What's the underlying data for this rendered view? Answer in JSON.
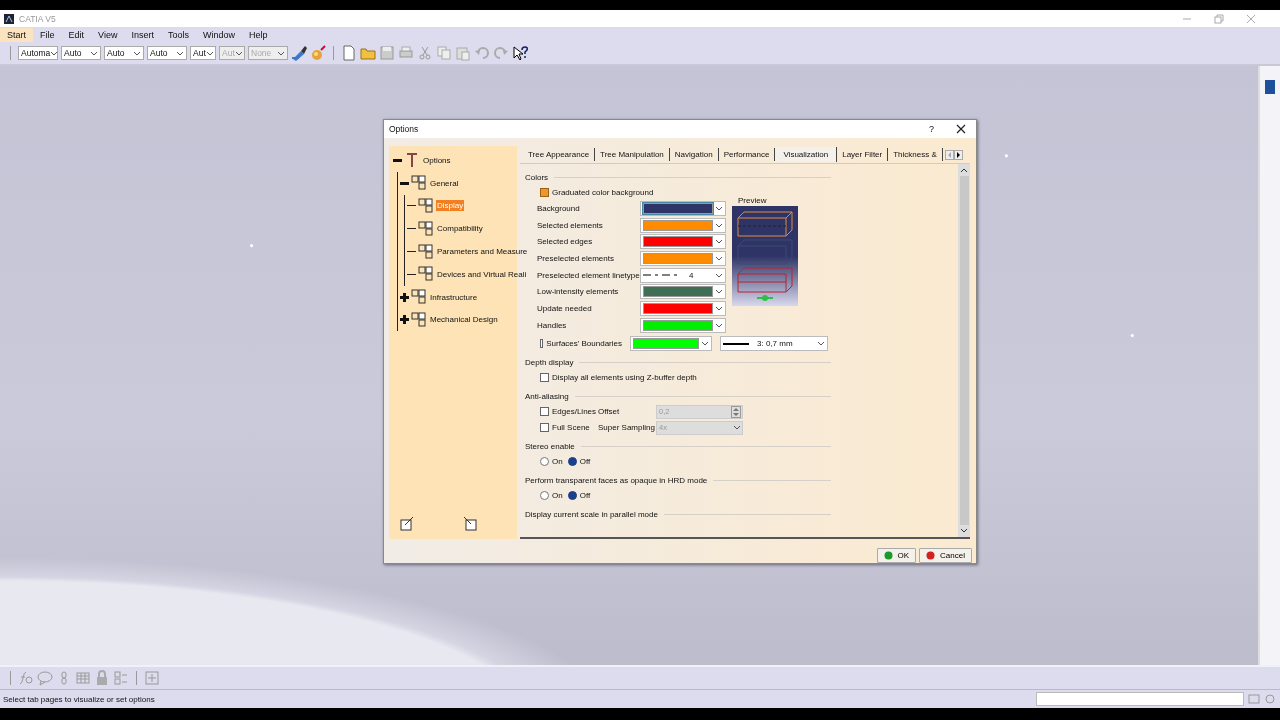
{
  "window": {
    "title": "CATIA V5"
  },
  "menu": [
    {
      "label": "Start",
      "selected": true
    },
    {
      "label": "File",
      "selected": false
    },
    {
      "label": "Edit",
      "selected": false
    },
    {
      "label": "View",
      "selected": false
    },
    {
      "label": "Insert",
      "selected": false
    },
    {
      "label": "Tools",
      "selected": false
    },
    {
      "label": "Window",
      "selected": false
    },
    {
      "label": "Help",
      "selected": false
    }
  ],
  "toolbar_combos": [
    {
      "value": "Automa",
      "disabled": false
    },
    {
      "value": "Auto",
      "disabled": false
    },
    {
      "value": "Auto",
      "disabled": false
    },
    {
      "value": "Auto",
      "disabled": false
    },
    {
      "value": "Aut",
      "disabled": false
    },
    {
      "value": "Aut",
      "disabled": true
    },
    {
      "value": "None",
      "disabled": true
    }
  ],
  "dialog": {
    "title": "Options",
    "help": "?",
    "tree": [
      {
        "label": "Options",
        "selected": false,
        "expanded": true,
        "children": [
          {
            "label": "General",
            "selected": false,
            "expanded": true,
            "children": [
              {
                "label": "Display",
                "selected": true
              },
              {
                "label": "Compatibility",
                "selected": false
              },
              {
                "label": "Parameters and Measure",
                "selected": false
              },
              {
                "label": "Devices and Virtual Reali",
                "selected": false
              }
            ]
          },
          {
            "label": "Infrastructure",
            "selected": false,
            "expanded": false
          },
          {
            "label": "Mechanical Design",
            "selected": false,
            "expanded": false
          }
        ]
      }
    ],
    "tabs": [
      {
        "label": "Tree Appearance",
        "selected": false
      },
      {
        "label": "Tree Manipulation",
        "selected": false
      },
      {
        "label": "Navigation",
        "selected": false
      },
      {
        "label": "Performance",
        "selected": false
      },
      {
        "label": "Visualization",
        "selected": true
      },
      {
        "label": "Layer Filter",
        "selected": false
      },
      {
        "label": "Thickness &",
        "selected": false
      }
    ],
    "colors": {
      "title": "Colors",
      "graduated": {
        "label": "Graduated color background",
        "checked": true
      },
      "preview_label": "Preview",
      "rows": [
        {
          "label": "Background",
          "kind": "color",
          "color": "#2e3466"
        },
        {
          "label": "Selected elements",
          "kind": "color",
          "color": "#ff8c00"
        },
        {
          "label": "Selected edges",
          "kind": "color",
          "color": "#ff0000"
        },
        {
          "label": "Preselected elements",
          "kind": "color",
          "color": "#ff8c00"
        },
        {
          "label": "Preselected element linetype",
          "kind": "linetype",
          "value": "4"
        },
        {
          "label": "Low-intensity elements",
          "kind": "color",
          "color": "#3f6e55"
        },
        {
          "label": "Update needed",
          "kind": "color",
          "color": "#ff0000"
        },
        {
          "label": "Handles",
          "kind": "color",
          "color": "#00ee00"
        }
      ],
      "surfaces": {
        "label": "Surfaces' Boundaries",
        "checked": false,
        "color": "#00ff00",
        "thickness": "3: 0,7 mm"
      }
    },
    "depth": {
      "title": "Depth display",
      "option": {
        "label": "Display all elements using Z-buffer depth",
        "checked": false
      }
    },
    "antialiasing": {
      "title": "Anti-aliasing",
      "rows": [
        {
          "label": "Edges/Lines",
          "checked": false,
          "field_label": "Offset",
          "value": "0,2",
          "kind": "spin",
          "disabled": true
        },
        {
          "label": "Full Scene",
          "checked": false,
          "field_label": "Super Sampling",
          "value": "4x",
          "kind": "combo",
          "disabled": true
        }
      ]
    },
    "stereo": {
      "title": "Stereo enable",
      "options": [
        {
          "label": "On",
          "selected": false
        },
        {
          "label": "Off",
          "selected": true
        }
      ]
    },
    "transparent": {
      "title": "Perform transparent faces as opaque in HRD mode",
      "options": [
        {
          "label": "On",
          "selected": false
        },
        {
          "label": "Off",
          "selected": true
        }
      ]
    },
    "scale": {
      "title": "Display current scale in parallel mode"
    },
    "buttons": [
      {
        "label": "OK",
        "kind": "ok"
      },
      {
        "label": "Cancel",
        "kind": "cancel"
      }
    ]
  },
  "status_bar": {
    "text": "Select tab pages to visualize or set options"
  }
}
